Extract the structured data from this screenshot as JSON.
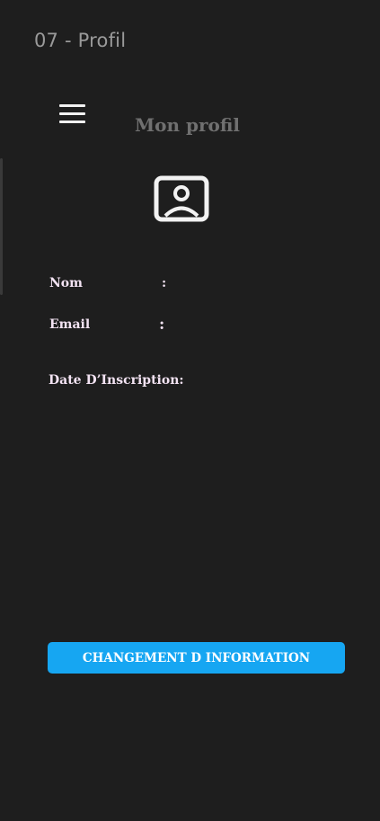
{
  "frame": {
    "title": "07 - Profil"
  },
  "header": {
    "menu_icon": "hamburger-menu-icon",
    "title": "Mon profil",
    "title_color": "#707070"
  },
  "profile": {
    "avatar_icon": "user-portrait-icon",
    "fields": [
      {
        "label": "Nom",
        "separator": ":"
      },
      {
        "label": "Email",
        "separator": ":"
      },
      {
        "label": "Date D’Inscription:"
      }
    ]
  },
  "actions": {
    "change_info_label": "CHANGEMENT D INFORMATION",
    "button_color": "#16a6f2"
  },
  "colors": {
    "background": "#1e1e1e",
    "label_text": "#f3e3f3"
  }
}
